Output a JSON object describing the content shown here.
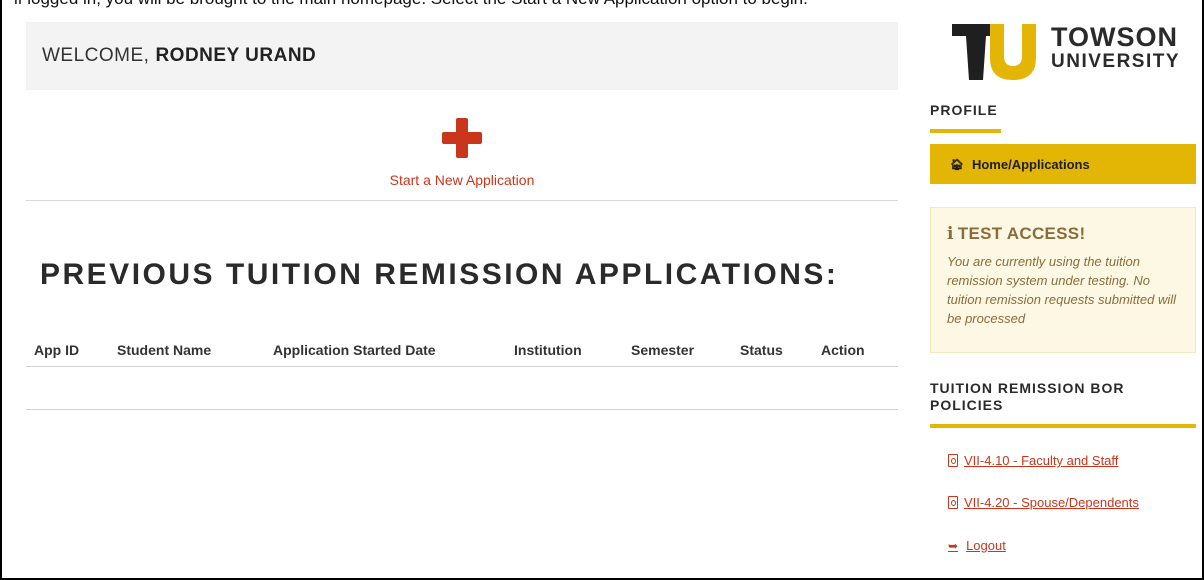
{
  "top_text": "if logged in, you will be brought to the main homepage.  Select the Start a New Application option to begin.",
  "welcome": {
    "prefix": "WELCOME, ",
    "name": "RODNEY URAND"
  },
  "start_app": {
    "label": "Start a New Application",
    "icon": "plus-icon"
  },
  "previous": {
    "title": "PREVIOUS TUITION REMISSION APPLICATIONS:",
    "columns": [
      "App ID",
      "Student Name",
      "Application Started Date",
      "Institution",
      "Semester",
      "Status",
      "Action"
    ],
    "rows": []
  },
  "logo": {
    "line1": "TOWSON",
    "line2": "UNIVERSITY"
  },
  "sidebar": {
    "profile_heading": "PROFILE",
    "home_item": {
      "label": "Home/Applications",
      "icon": "home-icon"
    },
    "test_access": {
      "title": "TEST ACCESS!",
      "body": "You are currently using the tuition remission system under testing. No tuition remission requests submitted will be processed"
    },
    "policies_heading": "TUITION REMISSION BOR POLICIES",
    "policies": [
      {
        "label": "VII-4.10 - Faculty and Staff",
        "icon": "pdf-icon"
      },
      {
        "label": "VII-4.20 - Spouse/Dependents",
        "icon": "pdf-icon"
      }
    ],
    "logout": {
      "label": "Logout",
      "icon": "logout-icon"
    }
  },
  "colors": {
    "accent_gold": "#e3b505",
    "link_red": "#c9361b",
    "alert_bg": "#fcf8e3",
    "alert_text": "#8a6d3b"
  }
}
